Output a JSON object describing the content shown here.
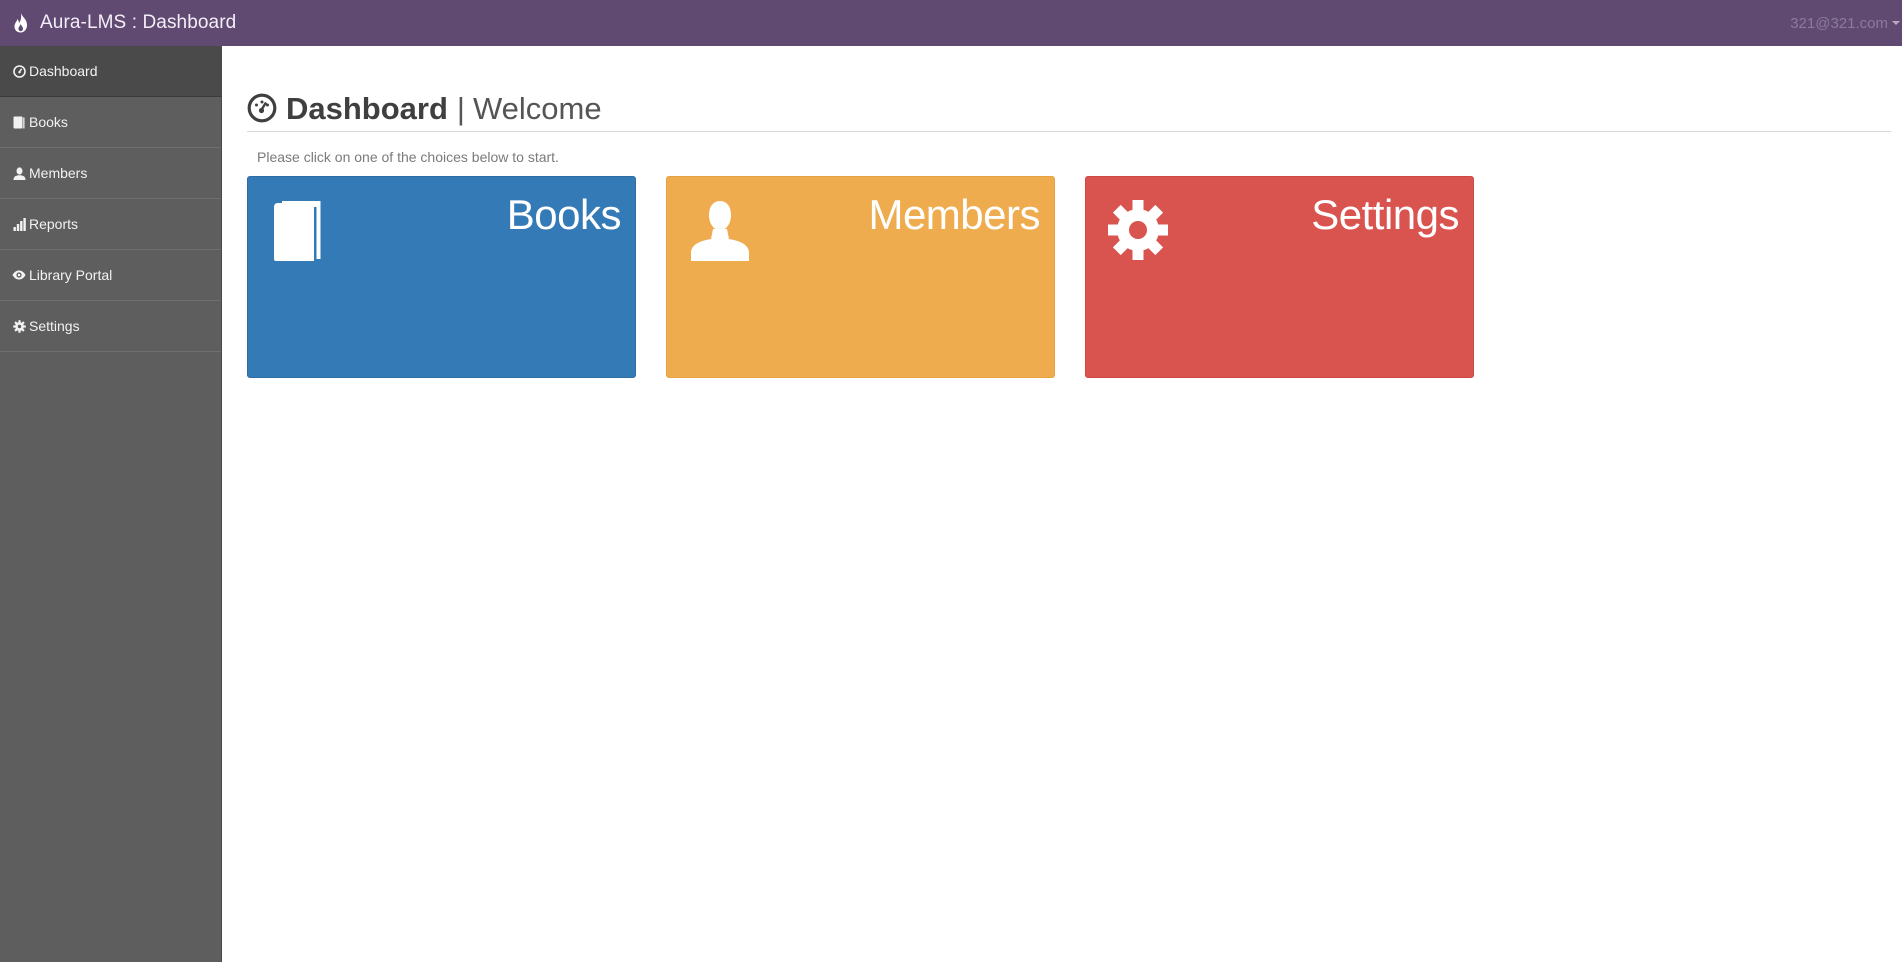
{
  "app": {
    "title": "Aura-LMS : Dashboard",
    "brand_icon": "flame-icon"
  },
  "user": {
    "email": "321@321.com"
  },
  "sidebar": {
    "items": [
      {
        "label": "Dashboard",
        "icon": "dashboard-icon",
        "active": true
      },
      {
        "label": "Books",
        "icon": "book-icon",
        "active": false
      },
      {
        "label": "Members",
        "icon": "user-icon",
        "active": false
      },
      {
        "label": "Reports",
        "icon": "bar-chart-icon",
        "active": false
      },
      {
        "label": "Library Portal",
        "icon": "eye-icon",
        "active": false
      },
      {
        "label": "Settings",
        "icon": "gear-icon",
        "active": false
      }
    ]
  },
  "header": {
    "title": "Dashboard",
    "separator": "|",
    "subtitle": "Welcome",
    "icon": "dashboard-icon"
  },
  "instructions": "Please click on one of the choices below to start.",
  "tiles": [
    {
      "label": "Books",
      "icon": "book-icon",
      "color": "#337ab7"
    },
    {
      "label": "Members",
      "icon": "user-icon",
      "color": "#efac4e"
    },
    {
      "label": "Settings",
      "icon": "gear-icon",
      "color": "#d9534f"
    }
  ],
  "colors": {
    "topbar": "#604a72",
    "sidebar": "#5e5e5e",
    "sidebar_active": "#4a4a4a"
  }
}
